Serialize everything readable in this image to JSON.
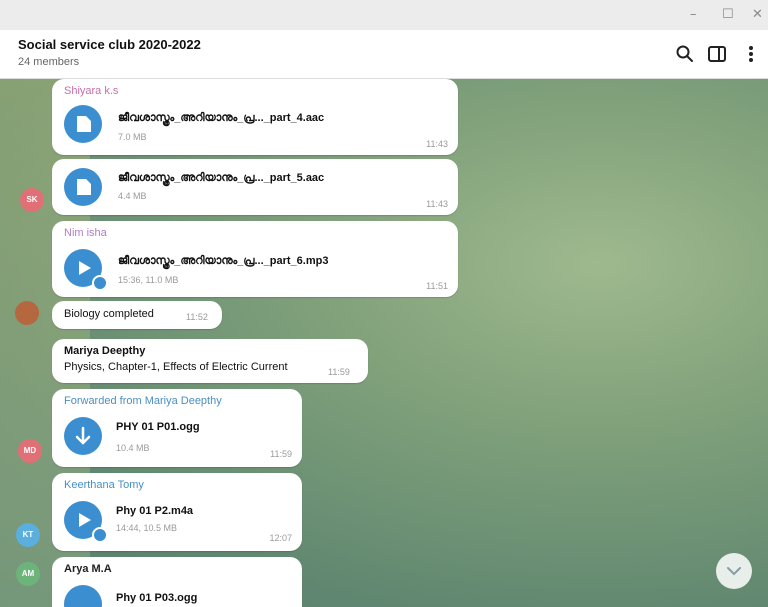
{
  "window": {
    "minimize": "–",
    "maximize": "☐",
    "close": "✕"
  },
  "chat": {
    "title": "Social service club 2020-2022",
    "subtitle": "24 members"
  },
  "header_icons": [
    "search-icon",
    "side-panel-icon",
    "more-vert-icon"
  ],
  "colors": {
    "accent": "#3b8fd0",
    "bubble": "#ffffff",
    "sender": "#4a8fc4"
  },
  "messages": {
    "m1": {
      "sender": "Shiyara k.s",
      "file": "ജീവശാസ്ത്രം_അറിയാനും_പ്ര..._part_4.aac",
      "size": "7.0 MB",
      "time": "11:43"
    },
    "m2": {
      "file": "ജീവശാസ്ത്രം_അറിയാനും_പ്ര..._part_5.aac",
      "size": "4.4 MB",
      "time": "11:43",
      "avatar": "SK"
    },
    "m3": {
      "sender": "Nim isha",
      "file": "ജീവശാസ്ത്രം_അറിയാനും_പ്ര..._part_6.mp3",
      "size": "15:36, 11.0 MB",
      "time": "11:51"
    },
    "m4": {
      "text": "Biology completed",
      "time": "11:52"
    },
    "m5": {
      "sender": "Mariya Deepthy",
      "text": "Physics, Chapter-1, Effects of Electric Current",
      "time": "11:59"
    },
    "m6": {
      "forwarded": "Forwarded from Mariya Deepthy",
      "file": "PHY 01 P01.ogg",
      "size": "10.4 MB",
      "time": "11:59",
      "avatar": "MD"
    },
    "m7": {
      "sender": "Keerthana Tomy",
      "file": "Phy 01 P2.m4a",
      "size": "14:44, 10.5 MB",
      "time": "12:07",
      "avatar": "KT"
    },
    "m8": {
      "sender": "Arya M.A",
      "file": "Phy 01 P03.ogg",
      "avatar": "AM"
    }
  }
}
